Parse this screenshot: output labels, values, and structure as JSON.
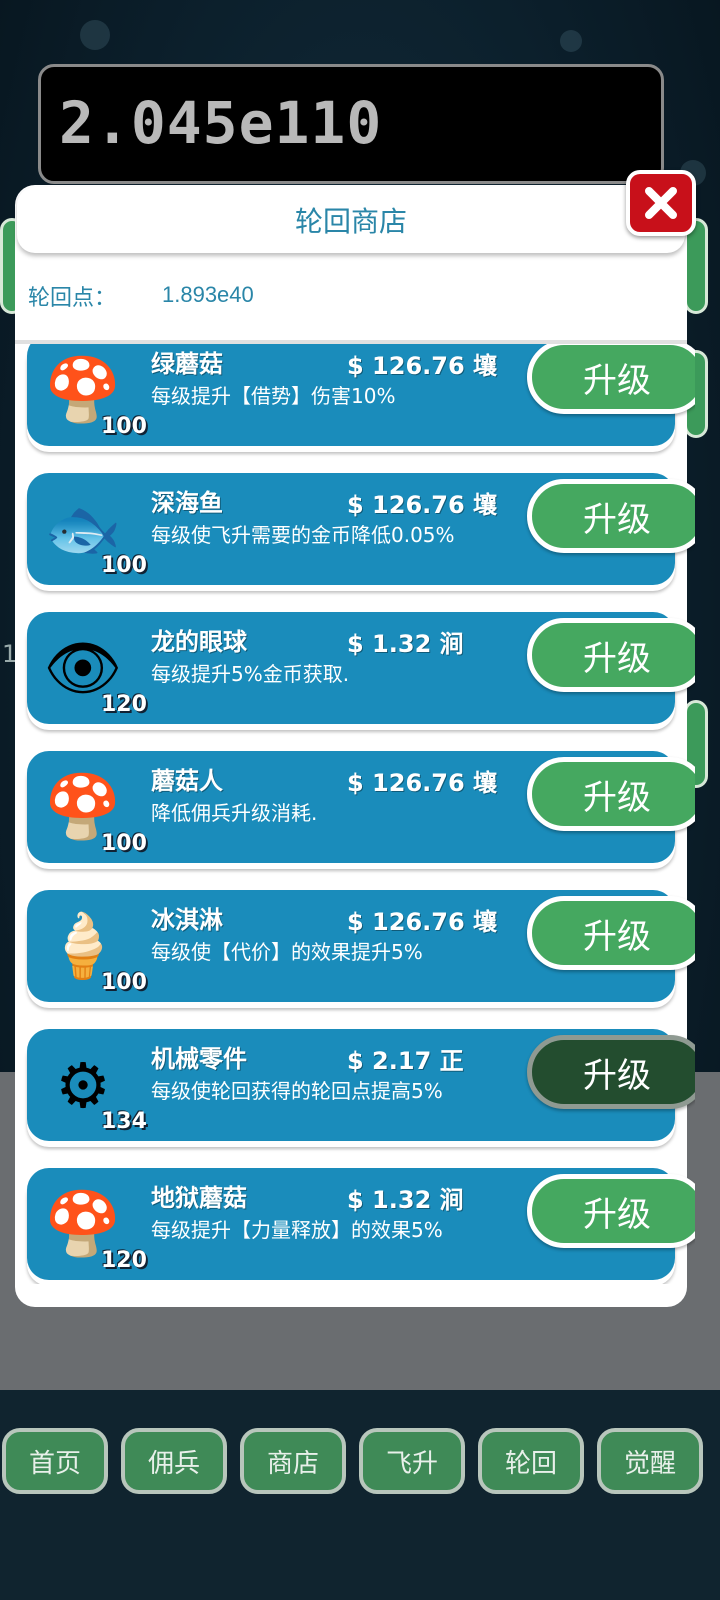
{
  "header": {
    "gold": "2.045e110"
  },
  "side": {
    "partial_number": "1"
  },
  "modal": {
    "title": "轮回商店",
    "points_label": "轮回点：",
    "points_value": "1.893e40",
    "close_icon": "close-x-icon"
  },
  "items": [
    {
      "name": "绿蘑菇",
      "price": "$ 126.76 壤",
      "desc": "每级提升【借势】伤害10%",
      "level": "100",
      "icon": "green-mushroom-icon",
      "button": "升级",
      "disabled": false
    },
    {
      "name": "深海鱼",
      "price": "$ 126.76 壤",
      "desc": "每级使飞升需要的金币降低0.05%",
      "level": "100",
      "icon": "deep-sea-fish-icon",
      "button": "升级",
      "disabled": false
    },
    {
      "name": "龙的眼球",
      "price": "$ 1.32 涧",
      "desc": "每级提升5%金币获取.",
      "level": "120",
      "icon": "dragon-eyeball-icon",
      "button": "升级",
      "disabled": false
    },
    {
      "name": "蘑菇人",
      "price": "$ 126.76 壤",
      "desc": "降低佣兵升级消耗.",
      "level": "100",
      "icon": "mushroom-man-icon",
      "button": "升级",
      "disabled": false
    },
    {
      "name": "冰淇淋",
      "price": "$ 126.76 壤",
      "desc": "每级使【代价】的效果提升5%",
      "level": "100",
      "icon": "ice-cream-icon",
      "button": "升级",
      "disabled": false
    },
    {
      "name": "机械零件",
      "price": "$ 2.17 正",
      "desc": "每级使轮回获得的轮回点提高5%",
      "level": "134",
      "icon": "mechanical-part-icon",
      "button": "升级",
      "disabled": true
    },
    {
      "name": "地狱蘑菇",
      "price": "$ 1.32 涧",
      "desc": "每级提升【力量释放】的效果5%",
      "level": "120",
      "icon": "hell-mushroom-icon",
      "button": "升级",
      "disabled": false
    }
  ],
  "nav": [
    "首页",
    "佣兵",
    "商店",
    "飞升",
    "轮回",
    "觉醒"
  ]
}
